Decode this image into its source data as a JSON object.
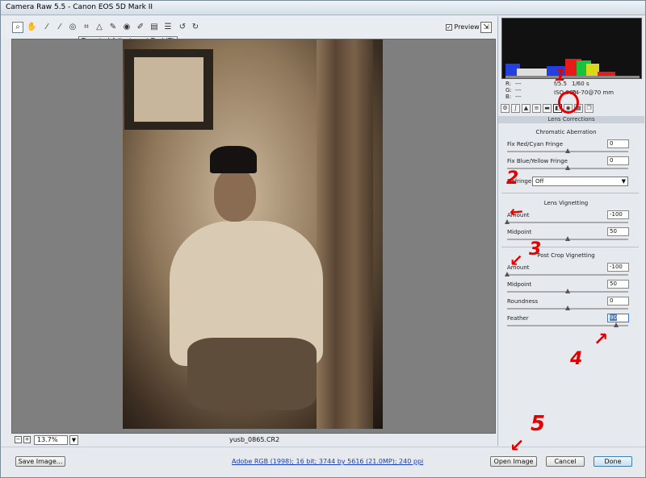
{
  "window": {
    "title": "Camera Raw 5.5  -  Canon EOS 5D Mark II"
  },
  "toolbar": {
    "tools": [
      "zoom-tool",
      "hand-tool",
      "white-balance-tool",
      "color-sampler-tool",
      "targeted-adjustment-tool",
      "crop-tool",
      "straighten-tool",
      "spot-removal-tool",
      "red-eye-tool",
      "adjustment-brush-tool",
      "graduated-filter-tool",
      "preferences",
      "rotate-ccw",
      "rotate-cw"
    ],
    "tooltip": "Targeted Adjustment Tool (T)",
    "preview_label": "Preview",
    "preview_checked": "✓"
  },
  "status": {
    "zoom_value": "13.7%",
    "filename": "yusb_0865.CR2"
  },
  "readout": {
    "r_label": "R:",
    "g_label": "G:",
    "b_label": "B:",
    "r_val": "---",
    "g_val": "---",
    "b_val": "---",
    "aperture": "f/5.5",
    "shutter": "1/60 s",
    "iso": "ISO 800",
    "lens": "24-70@70 mm"
  },
  "panel": {
    "title": "Lens Corrections",
    "chromatic_title": "Chromatic Aberration",
    "fix_red_cyan_label": "Fix Red/Cyan Fringe",
    "fix_red_cyan_value": "0",
    "fix_red_cyan_level": 0.5,
    "fix_blue_yellow_label": "Fix Blue/Yellow Fringe",
    "fix_blue_yellow_value": "0",
    "fix_blue_yellow_level": 0.5,
    "defringe_label": "Defringe:",
    "defringe_value": "Off",
    "lens_vignetting_title": "Lens Vignetting",
    "lv_amount_label": "Amount",
    "lv_amount_value": "-100",
    "lv_amount_level": 0,
    "lv_midpoint_label": "Midpoint",
    "lv_midpoint_value": "50",
    "lv_midpoint_level": 0.5,
    "post_crop_title": "Post Crop Vignetting",
    "pc_amount_label": "Amount",
    "pc_amount_value": "-100",
    "pc_amount_level": 0,
    "pc_midpoint_label": "Midpoint",
    "pc_midpoint_value": "50",
    "pc_midpoint_level": 0.5,
    "pc_roundness_label": "Roundness",
    "pc_roundness_value": "0",
    "pc_roundness_level": 0.5,
    "pc_feather_label": "Feather",
    "pc_feather_value": "90",
    "pc_feather_level": 0.9
  },
  "bottom": {
    "save_label": "Save Image...",
    "workflow_link": "Adobe RGB (1998); 16 bit; 3744 by 5616 (21.0MP); 240 ppi",
    "open_label": "Open Image",
    "cancel_label": "Cancel",
    "done_label": "Done"
  },
  "annotations": [
    "1",
    "2",
    "3",
    "4",
    "5"
  ],
  "colors": {
    "annotation": "#e20000",
    "accent": "#3a78c9"
  }
}
